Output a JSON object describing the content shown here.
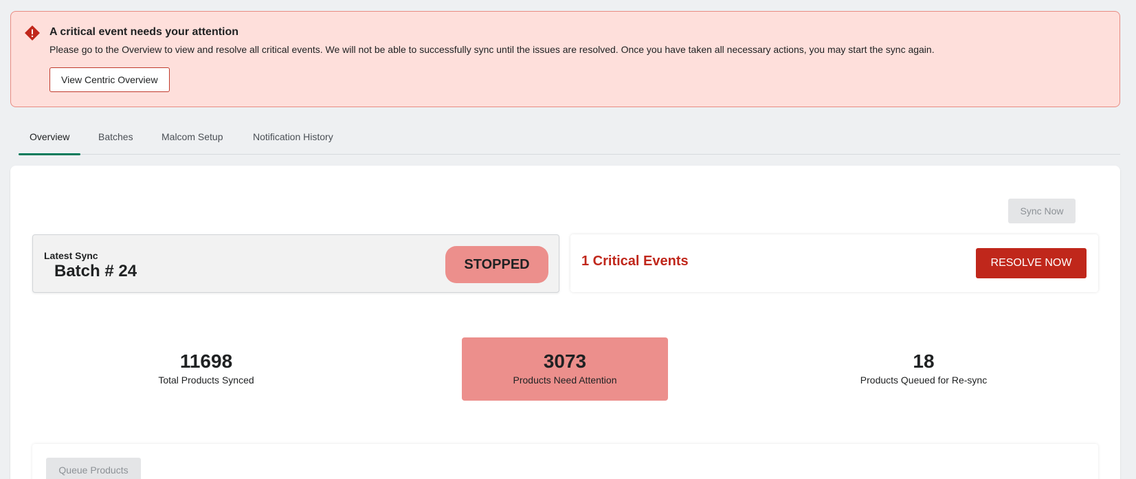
{
  "alert": {
    "icon": "warning-diamond-icon",
    "title": "A critical event needs your attention",
    "body": "Please go to the Overview to view and resolve all critical events. We will not be able to successfully sync until the issues are resolved. Once you have taken all necessary actions, you may start the sync again.",
    "button_label": "View Centric Overview",
    "colors": {
      "background": "#fedfdb",
      "border": "#e88b82",
      "icon": "#c0271b"
    }
  },
  "tabs": [
    {
      "label": "Overview",
      "active": true
    },
    {
      "label": "Batches",
      "active": false
    },
    {
      "label": "Malcom Setup",
      "active": false
    },
    {
      "label": "Notification History",
      "active": false
    }
  ],
  "tab_accent_color": "#007a5a",
  "toolbar": {
    "sync_now_label": "Sync Now",
    "sync_now_disabled": true
  },
  "latest_sync": {
    "label": "Latest Sync",
    "batch": "Batch # 24",
    "status": "STOPPED",
    "status_color": "#ec8f8c"
  },
  "critical": {
    "text": "1 Critical Events",
    "button_label": "RESOLVE NOW",
    "color": "#c0271b"
  },
  "stats": [
    {
      "value": "11698",
      "label": "Total Products Synced",
      "highlight": false
    },
    {
      "value": "3073",
      "label": "Products Need Attention",
      "highlight": true
    },
    {
      "value": "18",
      "label": "Products Queued for Re-sync",
      "highlight": false
    }
  ],
  "queue": {
    "button_label": "Queue Products",
    "disabled": true
  }
}
